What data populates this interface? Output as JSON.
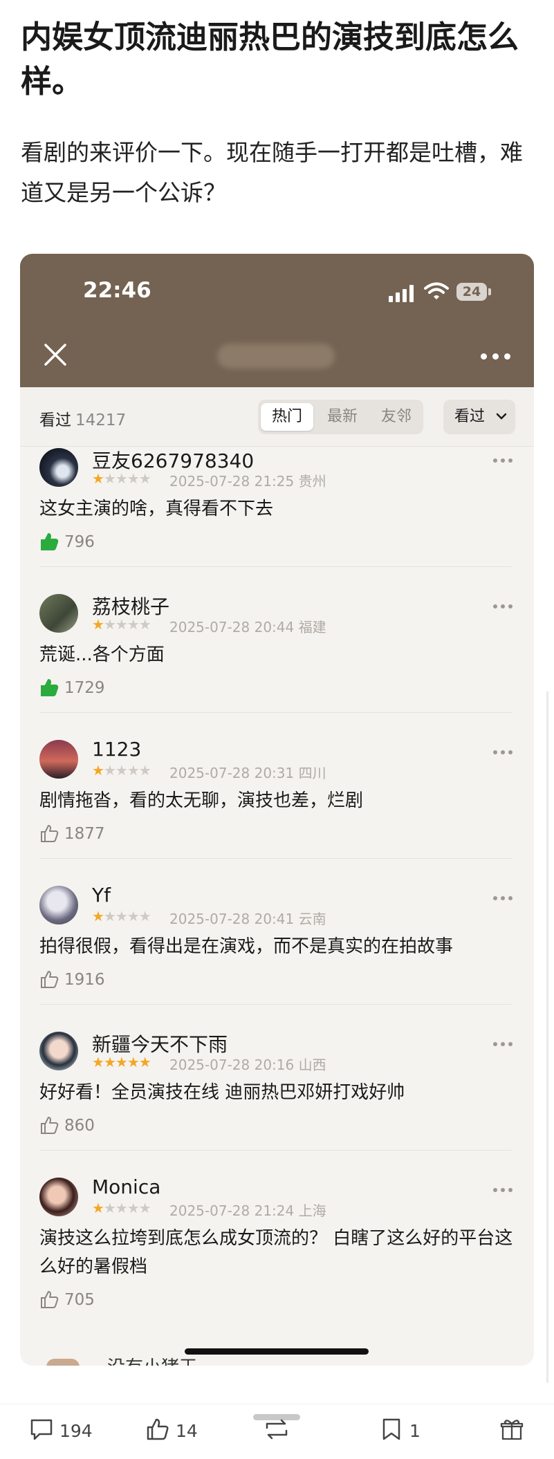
{
  "post": {
    "title": "内娱女顶流迪丽热巴的演技到底怎么样。",
    "body": "看剧的来评价一下。现在随手一打开都是吐槽，难道又是另一个公诉？"
  },
  "screenshot": {
    "status_time": "22:46",
    "battery": "24",
    "filter_bar": {
      "seen_label": "看过",
      "seen_count": "14217",
      "tabs": [
        "热门",
        "最新",
        "友邻"
      ],
      "active_tab": "热门",
      "dropdown_label": "看过"
    },
    "comments": [
      {
        "user": "豆友6267978340",
        "rating": 1,
        "date": "2025-07-28 21:25",
        "location": "贵州",
        "text": "这女主演的啥，真得看不下去",
        "likes": "796",
        "liked": true
      },
      {
        "user": "荔枝桃子",
        "rating": 1,
        "date": "2025-07-28 20:44",
        "location": "福建",
        "text": "荒诞...各个方面",
        "likes": "1729",
        "liked": true
      },
      {
        "user": "1123",
        "rating": 1,
        "date": "2025-07-28 20:31",
        "location": "四川",
        "text": "剧情拖沓，看的太无聊，演技也差，烂剧",
        "likes": "1877",
        "liked": false
      },
      {
        "user": "Yf",
        "rating": 1,
        "date": "2025-07-28 20:41",
        "location": "云南",
        "text": "拍得很假，看得出是在演戏，而不是真实的在拍故事",
        "likes": "1916",
        "liked": false
      },
      {
        "user": "新疆今天不下雨",
        "rating": 5,
        "date": "2025-07-28 20:16",
        "location": "山西",
        "text": "好好看！全员演技在线 迪丽热巴邓妍打戏好帅",
        "likes": "860",
        "liked": false
      },
      {
        "user": "Monica",
        "rating": 1,
        "date": "2025-07-28 21:24",
        "location": "上海",
        "text": "演技这么拉垮到底怎么成女顶流的？ 白瞎了这么好的平台这么好的暑假档",
        "likes": "705",
        "liked": false
      }
    ],
    "peek_user": "没有小猪王"
  },
  "bottom_bar": {
    "comments": "194",
    "likes": "14",
    "bookmarks": "1"
  },
  "colors": {
    "header_brown": "#746352",
    "star": "#f5a623",
    "liked_green": "#2aab3e"
  },
  "icons": [
    "close-icon",
    "more-icon",
    "signal-icon",
    "wifi-icon",
    "battery-icon",
    "thumb-up-icon",
    "comment-icon",
    "repost-icon",
    "bookmark-icon",
    "gift-icon",
    "chevron-down-icon"
  ]
}
